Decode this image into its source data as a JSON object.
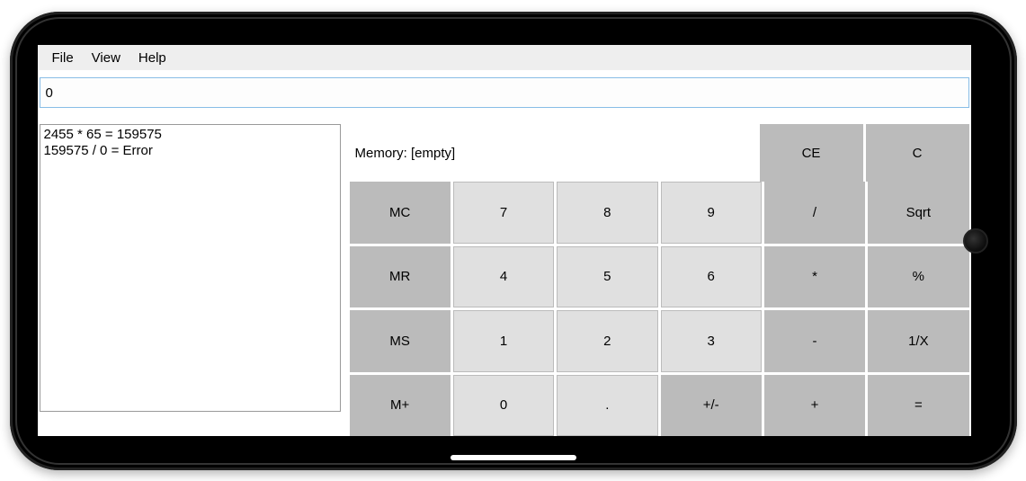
{
  "menubar": {
    "file": "File",
    "view": "View",
    "help": "Help"
  },
  "display": {
    "value": "0"
  },
  "history": {
    "text": "2455 * 65 = 159575\n159575 / 0 = Error"
  },
  "memory": {
    "label": "Memory: [empty]"
  },
  "clear": {
    "ce": "CE",
    "c": "C"
  },
  "keys": {
    "mc": "MC",
    "mr": "MR",
    "ms": "MS",
    "mplus": "M+",
    "d7": "7",
    "d8": "8",
    "d9": "9",
    "d4": "4",
    "d5": "5",
    "d6": "6",
    "d1": "1",
    "d2": "2",
    "d3": "3",
    "d0": "0",
    "dot": ".",
    "div": "/",
    "mul": "*",
    "sub": "-",
    "add": "+",
    "sqrt": "Sqrt",
    "pct": "%",
    "inv": "1/X",
    "eq": "=",
    "sign": "+/-"
  }
}
